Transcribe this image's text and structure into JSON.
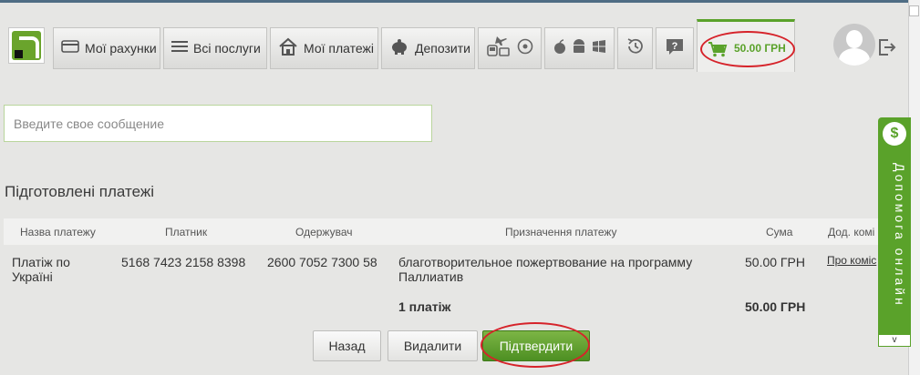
{
  "header": {
    "nav": [
      {
        "label": "Мої рахунки",
        "icon": "card-icon"
      },
      {
        "label": "Всі послуги",
        "icon": "list-icon"
      },
      {
        "label": "Мої платежі",
        "icon": "house-icon"
      },
      {
        "label": "Депозити",
        "icon": "piggy-bank-icon"
      }
    ],
    "icon_groups": [
      "transport-icons",
      "platform-icons",
      "history-icon",
      "help-icon"
    ],
    "cart": {
      "amount": "50.00 ГРН",
      "icon": "cart-icon"
    }
  },
  "message": {
    "placeholder": "Введите свое сообщение",
    "value": ""
  },
  "payments": {
    "title": "Підготовлені платежі",
    "columns": [
      "Назва платежу",
      "Платник",
      "Одержувач",
      "Призначення платежу",
      "Сума",
      "Дод. комі"
    ],
    "rows": [
      {
        "name_line1": "Платіж по",
        "name_line2": "Україні",
        "payer": "5168 7423 2158 8398",
        "recipient": "2600 7052 7300 58",
        "purpose_line1": "благотворительное пожертвование на программу",
        "purpose_line2": "Паллиатив",
        "amount": "50.00 ГРН",
        "extra_link": "Про коміс"
      }
    ],
    "total": {
      "count": "1 платіж",
      "amount": "50.00 ГРН"
    }
  },
  "buttons": {
    "back": "Назад",
    "delete": "Видалити",
    "confirm": "Підтвердити"
  },
  "help_tab": {
    "label": "Допомога онлайн",
    "arrow": "v",
    "icon": "dollar-icon"
  },
  "colors": {
    "accent_green": "#5aa22a",
    "highlight_red": "#d6232a",
    "background": "#e6e6e4"
  }
}
